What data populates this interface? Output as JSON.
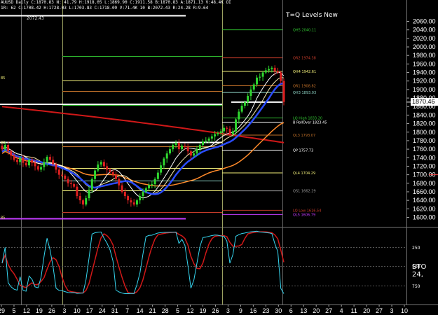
{
  "header": {
    "line1": "AUUSD Daily  C:1870.83  N: 41.79  H:1918.05  L:1869.90  C:1911.58  B:1870.83  A:1871.13  V:48.4K  OI",
    "line2": "1R: 62  C:1708.42  H:1728.03  L:1703.83  C:1718.09  V:71.4K  10  B:2072.43  R:24.28  R:9.64"
  },
  "study_title": "T=Q Levels New",
  "current_price_label": "1870.46",
  "top_left_small_label": "2072.43",
  "left_edge_labels": [
    {
      "text": "85",
      "y": 1928
    },
    {
      "text": "80",
      "y": 1776
    },
    {
      "text": "85",
      "y": 1600
    }
  ],
  "price_axis": {
    "labels": [
      "2060.00",
      "2040.00",
      "2020.00",
      "2000.00",
      "1980.00",
      "1960.00",
      "1940.00",
      "1920.00",
      "1900.00",
      "1880.00",
      "1860.00",
      "1840.00",
      "1820.00",
      "1800.00",
      "1780.00",
      "1760.00",
      "1740.00",
      "1720.00",
      "1700.00",
      "1680.00",
      "1660.00",
      "1640.00",
      "1620.00",
      "1600.00"
    ],
    "min": 1590,
    "max": 2070
  },
  "levels": [
    {
      "label": "QH5 2040.11",
      "value": 2040.11,
      "color": "#31c431",
      "x_start_idx": 78
    },
    {
      "label": "QR2 1974.38",
      "value": 1974.38,
      "color": "#c43b2a",
      "x_start_idx": 78
    },
    {
      "label": "QH4 1942.61",
      "value": 1942.61,
      "color": "#f3f07a",
      "x_start_idx": 78
    },
    {
      "label": "QR1 1908.82",
      "value": 1908.82,
      "color": "#c4722a",
      "x_start_idx": 78
    },
    {
      "label": "QH3 1893.03",
      "value": 1893.03,
      "color": "#8fd6c8",
      "x_start_idx": 78
    },
    {
      "label": "LQ High 1833.20",
      "value": 1833.2,
      "color": "#31c431",
      "x_start_idx": 78
    },
    {
      "label": "B RollOver 1823.45",
      "value": 1823.45,
      "color": "#ffffff",
      "x_start_idx": 78
    },
    {
      "label": "QL3 1793.07",
      "value": 1793.07,
      "color": "#c4722a",
      "x_start_idx": 78
    },
    {
      "label": "QP 1757.73",
      "value": 1757.73,
      "color": "#ffffff",
      "x_start_idx": 78
    },
    {
      "label": "QL4 1704.29",
      "value": 1704.29,
      "color": "#f3f07a",
      "x_start_idx": 78
    },
    {
      "label": "QS1 1662.29",
      "value": 1662.29,
      "color": "#9a9a9a",
      "x_start_idx": 78
    },
    {
      "label": "LQ Low 1616.54",
      "value": 1616.54,
      "color": "#c43b2a",
      "x_start_idx": 78
    },
    {
      "label": "QL5 1606.79",
      "value": 1606.79,
      "color": "#c43bff",
      "x_start_idx": 78
    }
  ],
  "oscillator": {
    "label": "STO",
    "value_text": "24,",
    "axis_labels": [
      "250",
      "500",
      "750"
    ]
  },
  "time_axis": {
    "labels": [
      "29",
      "5",
      "12",
      "19",
      "26",
      "3",
      "10",
      "17",
      "24",
      "31",
      "7",
      "14",
      "21",
      "28",
      "5",
      "12",
      "19",
      "26",
      "3",
      "9",
      "16",
      "23",
      "30",
      "6",
      "13",
      "20",
      "27",
      "4",
      "11",
      "20",
      "27",
      "3",
      "10"
    ]
  },
  "colors": {
    "bull": "#2fd82f",
    "bear": "#e02020",
    "ma_blue": "#2a4cff",
    "ma_red": "#d01818",
    "ma_orange": "#ff8a2a",
    "ma_white": "#ffffff",
    "ma_cream": "#f4e8b0",
    "sto_k": "#36d6f0",
    "sto_d": "#d01818"
  },
  "chart_data": {
    "type": "candlestick",
    "title": "AUUSD Daily",
    "ylim": [
      1590,
      2070
    ],
    "closes": [
      1760,
      1770,
      1755,
      1745,
      1735,
      1730,
      1740,
      1728,
      1722,
      1735,
      1728,
      1720,
      1712,
      1718,
      1730,
      1742,
      1735,
      1725,
      1712,
      1700,
      1698,
      1690,
      1680,
      1678,
      1672,
      1650,
      1640,
      1630,
      1645,
      1665,
      1690,
      1710,
      1724,
      1730,
      1720,
      1712,
      1706,
      1700,
      1690,
      1675,
      1660,
      1650,
      1640,
      1635,
      1630,
      1640,
      1650,
      1660,
      1668,
      1676,
      1678,
      1690,
      1705,
      1722,
      1738,
      1750,
      1760,
      1770,
      1775,
      1760,
      1768,
      1765,
      1755,
      1745,
      1750,
      1760,
      1770,
      1778,
      1780,
      1785,
      1790,
      1795,
      1798,
      1802,
      1810,
      1808,
      1795,
      1802,
      1830,
      1848,
      1862,
      1870,
      1885,
      1900,
      1912,
      1928,
      1930,
      1940,
      1945,
      1948,
      1951,
      1943,
      1940,
      1920,
      1870.83
    ]
  }
}
